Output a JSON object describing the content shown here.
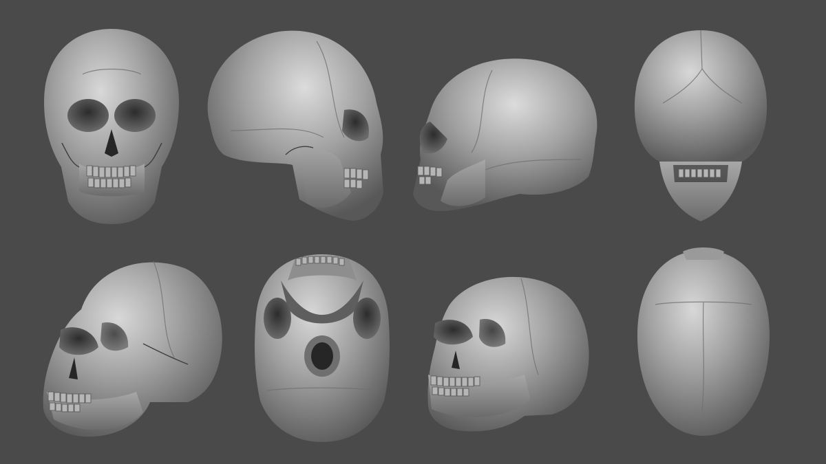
{
  "scene": {
    "background_color": "#4a4a4a",
    "bone_colors": {
      "highlight": "#d2d2d2",
      "mid": "#9d9d9d",
      "shadow": "#4e4e4e"
    },
    "views": [
      {
        "name": "front",
        "icon": "skull-front"
      },
      {
        "name": "right-side",
        "icon": "skull-side-right"
      },
      {
        "name": "left-side",
        "icon": "skull-side-left"
      },
      {
        "name": "back",
        "icon": "skull-back"
      },
      {
        "name": "three-quarter-left",
        "icon": "skull-three-quarter"
      },
      {
        "name": "bottom",
        "icon": "skull-base"
      },
      {
        "name": "three-quarter-right",
        "icon": "skull-three-quarter"
      },
      {
        "name": "top",
        "icon": "skull-top"
      }
    ]
  }
}
